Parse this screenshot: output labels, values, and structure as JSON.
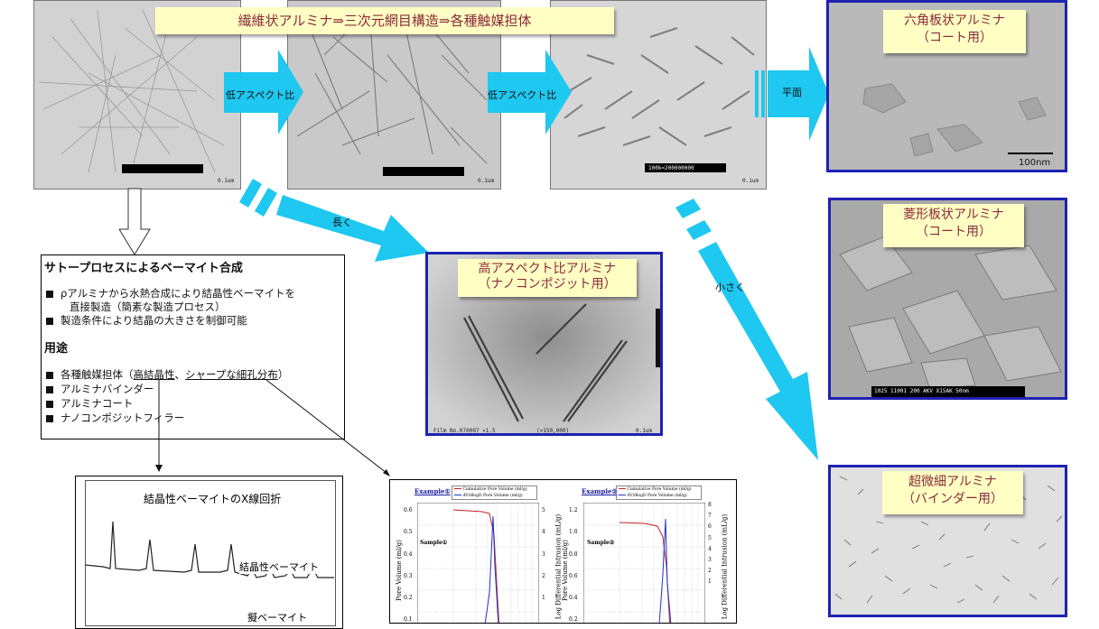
{
  "banner": {
    "title": "繊維状アルミナ⇒三次元網目構造⇒各種触媒担体"
  },
  "tem_images": {
    "img1": {
      "scale": "0.1um"
    },
    "img2": {
      "scale": "0.1um"
    },
    "img3": {
      "scale": "0.1um",
      "caption": "100k=200000000"
    },
    "hex": {
      "label_line1": "六角板状アルミナ",
      "label_line2": "（コート用）",
      "scale": "100nm"
    },
    "rhomb": {
      "label_line1": "菱形板状アルミナ",
      "label_line2": "（コート用）",
      "caption": "1025 11001 200 AKV X15AK 50nm"
    },
    "ultrafine": {
      "label_line1": "超微細アルミナ",
      "label_line2": "（バインダー用）"
    },
    "high": {
      "label_line1": "高アスペクト比アルミナ",
      "label_line2": "（ナノコンポジット用）",
      "caption_left": "Film No.070007 ×1.5",
      "caption_mid": "(×150,000)",
      "scale": "0.1um"
    }
  },
  "arrows": {
    "a1": "低アスペクト比",
    "a2": "低アスペクト比",
    "a3": "平面",
    "long": "長く",
    "small": "小さく"
  },
  "textbox": {
    "heading": "サトープロセスによるベーマイト合成",
    "bullets": [
      "ρアルミナから水熱合成により結晶性ベーマイトを",
      "直接製造（簡素な製造プロセス）",
      "製造条件により結晶の大きさを制御可能"
    ],
    "uses_heading": "用途",
    "uses_first_prefix": "各種触媒担体（",
    "uses_first_u1": "高結晶性",
    "uses_first_sep": "、",
    "uses_first_u2": "シャープな細孔分布",
    "uses_first_suffix": "）",
    "uses": [
      "アルミナバインダー",
      "アルミナコート",
      "ナノコンポジットフィラー"
    ]
  },
  "xrd": {
    "title": "結晶性ベーマイトのX線回折",
    "label1": "結晶性ベーマイト",
    "label2": "擬ベーマイト"
  },
  "pore": {
    "left": {
      "example": "Example①",
      "sample": "Sample①",
      "legend1": "Cumulative Pore Volume (ml/g)",
      "legend2": "dV/dlogD Pore Volume (ml/g)",
      "ylabel": "Pore Volume (ml/g)",
      "y2label": "Log Differential Intrusion (mL/g)",
      "yticks": [
        "0.6",
        "0.5",
        "0.4",
        "0.3",
        "0.2",
        "0.1"
      ],
      "y2ticks": [
        "5",
        "4",
        "3",
        "2",
        "1"
      ]
    },
    "right": {
      "example": "Example②",
      "sample": "Sample②",
      "legend1": "Cumulative Pore Volume (ml/g)",
      "legend2": "dV/dlogD Pore Volume (ml/g)",
      "ylabel": "Pore Volume (ml/g)",
      "y2label": "Log Differential Intrusion (mL/g)",
      "yticks": [
        "1.2",
        "1.0",
        "0.8",
        "0.6",
        "0.4",
        "0.2"
      ],
      "y2ticks": [
        "8",
        "7",
        "6",
        "5",
        "4",
        "3",
        "2",
        "1"
      ]
    }
  },
  "colors": {
    "arrow": "#1ec8f0",
    "frame": "#1e22b0",
    "note_bg": "#ffffc4",
    "note_text": "#8b2a3a",
    "curve_red": "#cc2222",
    "curve_blue": "#2233cc"
  }
}
